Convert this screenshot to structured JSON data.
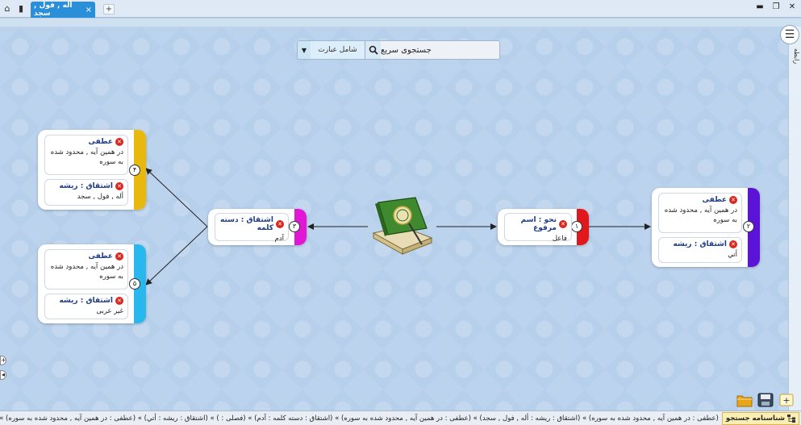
{
  "window": {
    "tab_title": "أله , فول , سجد",
    "tab_close": "×",
    "tab_add": "+"
  },
  "search": {
    "placeholder": "جستجوی سریع",
    "mode": "شامل عبارت"
  },
  "nodes": {
    "n1": {
      "number": "١",
      "color": "#e0181c",
      "items": [
        {
          "title": "نحو : اسم مرفوع",
          "desc": "فاعل"
        }
      ]
    },
    "n2": {
      "number": "٢",
      "color": "#5b13d8",
      "items": [
        {
          "title": "عطفی",
          "desc": "در همین آیه , محدود شده به سوره"
        },
        {
          "title": "اشتقاق : ریشه",
          "desc": "أتي"
        }
      ]
    },
    "n3": {
      "number": "٣",
      "color": "#e018d6",
      "items": [
        {
          "title": "اشتقاق : دسته کلمه",
          "desc": "آدم"
        }
      ]
    },
    "n4": {
      "number": "۴",
      "color": "#e8b90c",
      "items": [
        {
          "title": "عطفی",
          "desc": "در همین آیه , محدود شده به سوره"
        },
        {
          "title": "اشتقاق : ریشه",
          "desc": "أله , فول , سجد"
        }
      ]
    },
    "n5": {
      "number": "۵",
      "color": "#29b8ee",
      "items": [
        {
          "title": "عطفی",
          "desc": "در همین آیه , محدود شده به سوره"
        },
        {
          "title": "اشتقاق : ریشه",
          "desc": "غیر عربی"
        }
      ]
    }
  },
  "side": {
    "vertical_label": "رابطه"
  },
  "status": {
    "label": "شناسنامه جستجو",
    "text": "(عطفی : در همین آیه , محدود شده به سوره) » (اشتقاق : ریشه : أله , فول , سجد) » (عطفی : در همین آیه , محدود شده به سوره) » (اشتقاق : دسته کلمه : آدم) » (فصلی : ) » (اشتقاق : ریشه : أتي) » (عطفی : در همین آیه , محدود شده به سوره) » (اشتقاق : ریشه : غیر عربی)"
  },
  "colors": {
    "tab": "#2a8fd8",
    "canvas": "#b6cfeb",
    "status_label_bg": "#fbeeb3"
  }
}
